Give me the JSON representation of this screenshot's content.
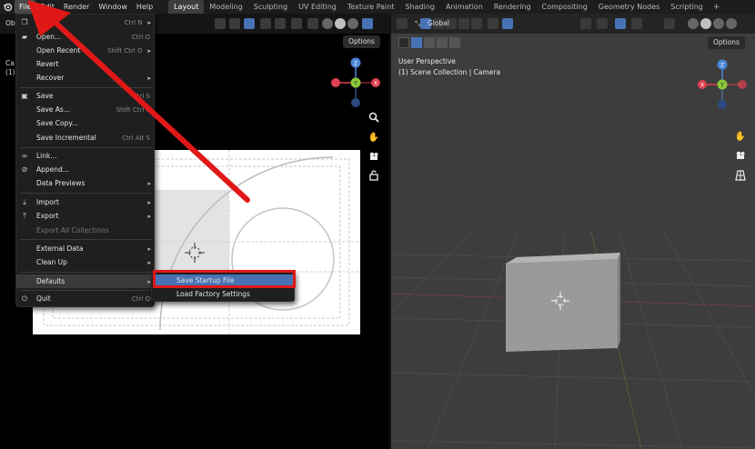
{
  "menubar": {
    "menus": [
      "File",
      "Edit",
      "Render",
      "Window",
      "Help"
    ],
    "workspaces": [
      "Layout",
      "Modeling",
      "Sculpting",
      "UV Editing",
      "Texture Paint",
      "Shading",
      "Animation",
      "Rendering",
      "Compositing",
      "Geometry Nodes",
      "Scripting"
    ],
    "add_tab": "+"
  },
  "left_view": {
    "options_label": "Options",
    "partial_label_1": "Ca",
    "partial_label_2": "(1)",
    "header_partial": "Ob"
  },
  "file_menu": {
    "items": [
      {
        "label": "New",
        "shortcut": "Ctrl N",
        "icon": "new-file-icon",
        "submenu": true
      },
      {
        "label": "Open...",
        "shortcut": "Ctrl O",
        "icon": "folder-icon"
      },
      {
        "label": "Open Recent",
        "shortcut": "Shift Ctrl O",
        "submenu": true
      },
      {
        "label": "Revert",
        "shortcut": ""
      },
      {
        "label": "Recover",
        "shortcut": "",
        "submenu": true
      },
      {
        "label": "Save",
        "shortcut": "Ctrl S",
        "icon": "save-icon"
      },
      {
        "label": "Save As...",
        "shortcut": "Shift Ctrl S"
      },
      {
        "label": "Save Copy...",
        "shortcut": ""
      },
      {
        "label": "Save Incremental",
        "shortcut": "Ctrl Alt S"
      },
      {
        "label": "Link...",
        "shortcut": "",
        "icon": "link-icon"
      },
      {
        "label": "Append...",
        "shortcut": "",
        "icon": "append-icon"
      },
      {
        "label": "Data Previews",
        "shortcut": "",
        "submenu": true
      },
      {
        "label": "Import",
        "shortcut": "",
        "icon": "import-icon",
        "submenu": true
      },
      {
        "label": "Export",
        "shortcut": "",
        "icon": "export-icon",
        "submenu": true
      },
      {
        "label": "Export All Collections",
        "shortcut": "",
        "disabled": true
      },
      {
        "label": "External Data",
        "shortcut": "",
        "submenu": true
      },
      {
        "label": "Clean Up",
        "shortcut": "",
        "submenu": true
      },
      {
        "label": "Defaults",
        "shortcut": "",
        "submenu": true
      },
      {
        "label": "Quit",
        "shortcut": "Ctrl Q",
        "icon": "power-icon"
      }
    ]
  },
  "defaults_submenu": {
    "items": [
      "Save Startup File",
      "Load Factory Settings"
    ]
  },
  "right_view": {
    "orientation": "Global",
    "options_label": "Options",
    "perspective_label": "User Perspective",
    "collection_label": "(1) Scene Collection | Camera"
  },
  "gizmo": {
    "x": "X",
    "y": "Y",
    "z": "Z"
  },
  "colors": {
    "annotation_red": "#e01818",
    "highlight_blue": "#4772b3",
    "axis_x": "#e04050",
    "axis_y": "#8ac83a",
    "axis_z": "#4a86d8"
  }
}
